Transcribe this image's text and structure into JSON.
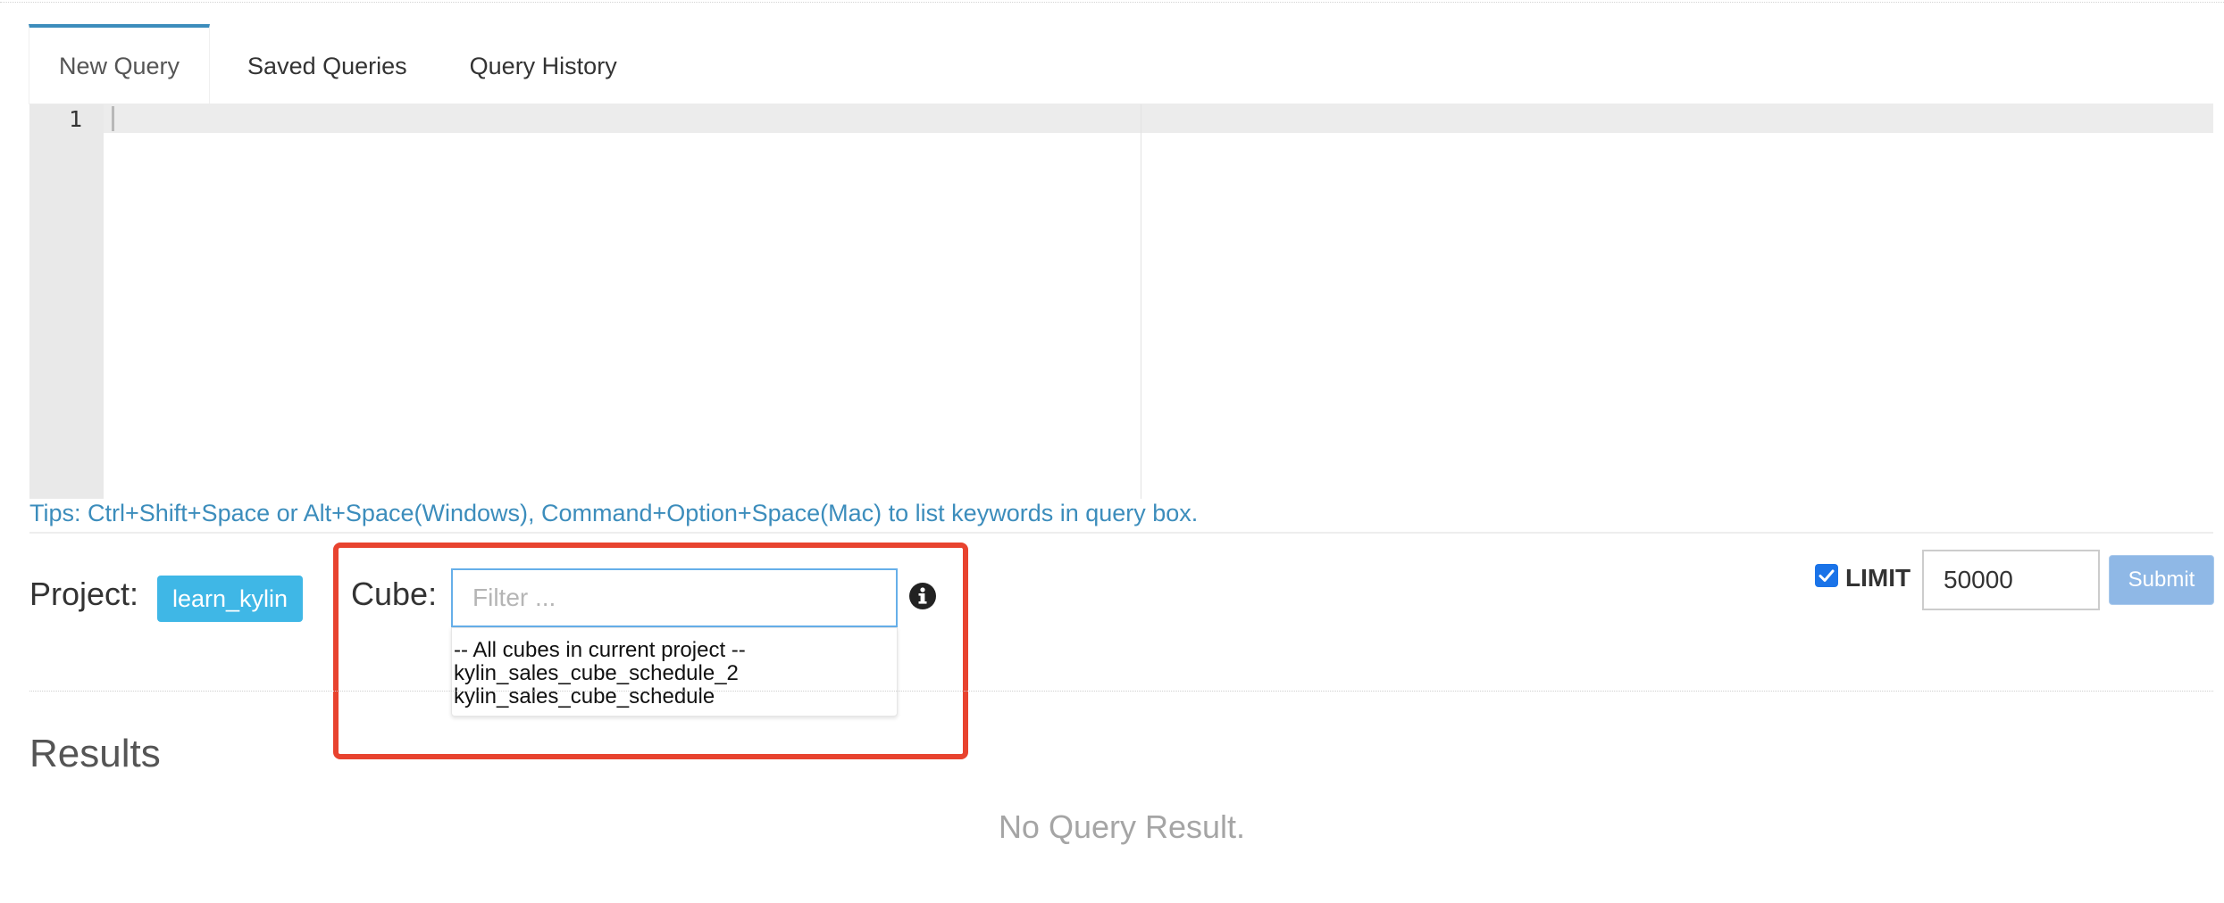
{
  "tabs": [
    {
      "label": "New Query",
      "active": true
    },
    {
      "label": "Saved Queries",
      "active": false
    },
    {
      "label": "Query History",
      "active": false
    }
  ],
  "editor": {
    "line_numbers": [
      "1"
    ]
  },
  "tips": "Tips: Ctrl+Shift+Space or Alt+Space(Windows), Command+Option+Space(Mac) to list keywords in query box.",
  "project": {
    "label": "Project:",
    "value": "learn_kylin"
  },
  "cube": {
    "label": "Cube:",
    "filter_placeholder": "Filter ...",
    "info_icon": "info-circle-icon",
    "options": [
      "-- All cubes in current project --",
      "kylin_sales_cube_schedule_2",
      "kylin_sales_cube_schedule"
    ]
  },
  "limit": {
    "checked": true,
    "label": "LIMIT",
    "value": "50000"
  },
  "submit_label": "Submit",
  "results": {
    "heading": "Results",
    "empty_text": "No Query Result."
  },
  "colors": {
    "accent": "#3c8dbc",
    "badge": "#3fb7e6",
    "highlight": "#e8432f",
    "submit": "#8fb8e6",
    "checkbox": "#1a73e8"
  }
}
